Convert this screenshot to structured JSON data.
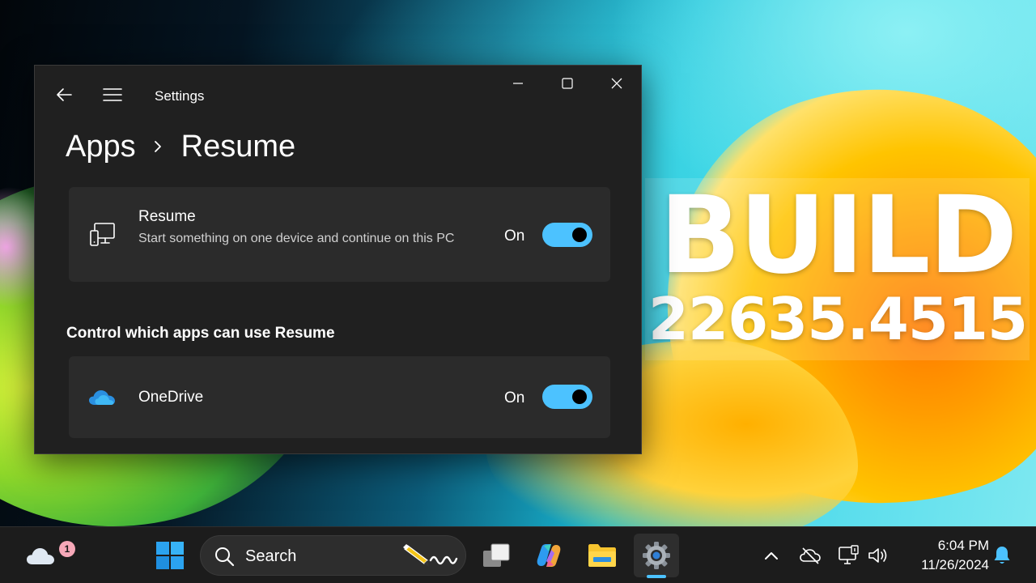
{
  "window": {
    "title": "Settings",
    "icons": {
      "back": "back-arrow-icon",
      "menu": "hamburger-menu-icon",
      "minimize": "minimize-icon",
      "maximize": "maximize-icon",
      "close": "close-icon"
    }
  },
  "breadcrumb": {
    "parent": "Apps",
    "current": "Resume"
  },
  "resume_card": {
    "icon": "devices-icon",
    "title": "Resume",
    "description": "Start something on one device and continue on this PC",
    "toggle_label": "On",
    "toggle_on": true
  },
  "section": {
    "heading": "Control which apps can use Resume"
  },
  "apps": [
    {
      "icon": "onedrive-cloud-icon",
      "name": "OneDrive",
      "toggle_label": "On",
      "toggle_on": true
    }
  ],
  "overlay": {
    "title": "BUILD",
    "number": "22635.4515"
  },
  "taskbar": {
    "weather_badge": "1",
    "search_placeholder": "Search",
    "items": [
      "start-icon",
      "search-icon",
      "task-view-icon",
      "copilot-icon",
      "file-explorer-icon",
      "settings-icon"
    ],
    "tray": [
      "chevron-up-icon",
      "onedrive-offline-icon",
      "network-icon",
      "volume-icon",
      "notification-bell-icon"
    ],
    "time": "6:04 PM",
    "date": "11/26/2024"
  },
  "colors": {
    "accent": "#4cc2ff",
    "window_bg": "#202020",
    "card_bg": "#2b2b2b",
    "taskbar_bg": "#1c1c1c"
  }
}
